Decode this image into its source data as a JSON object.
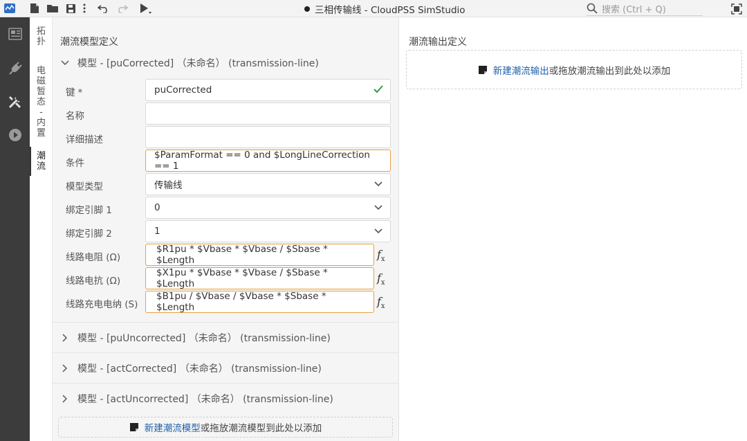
{
  "window": {
    "title": "三相传输线 - CloudPSS SimStudio",
    "search_placeholder": "搜索 (Ctrl + Q)"
  },
  "toolbar_icons": [
    "app-logo-icon",
    "new-file-icon",
    "open-folder-icon",
    "save-icon",
    "more-icon",
    "undo-icon",
    "redo-icon",
    "run-icon"
  ],
  "activity_icons": [
    "component-icon",
    "plug-icon",
    "tools-icon",
    "play-icon"
  ],
  "vertical_tabs": [
    {
      "label": "拓扑",
      "chars": [
        "拓",
        "扑"
      ]
    },
    {
      "label": "电磁暂态-内置",
      "chars": [
        "电",
        "磁",
        "暂",
        "态",
        "-",
        "内",
        "置"
      ]
    },
    {
      "label": "潮流",
      "chars": [
        "潮",
        "流"
      ]
    }
  ],
  "left_panel": {
    "title": "潮流模型定义",
    "expanded_model": {
      "header": "模型 - [puCorrected] （未命名） (transmission-line)",
      "fields": {
        "key_label": "键",
        "key_required": "*",
        "key_value": "puCorrected",
        "name_label": "名称",
        "name_value": "",
        "desc_label": "详细描述",
        "desc_value": "",
        "cond_label": "条件",
        "cond_value": "$ParamFormat == 0 and $LongLineCorrection == 1",
        "type_label": "模型类型",
        "type_value": "传输线",
        "pin1_label": "绑定引脚 1",
        "pin1_value": "0",
        "pin2_label": "绑定引脚 2",
        "pin2_value": "1",
        "r_label": "线路电阻 (Ω)",
        "r_value": "$R1pu * $Vbase * $Vbase / $Sbase * $Length",
        "x_label": "线路电抗 (Ω)",
        "x_value": "$X1pu * $Vbase * $Vbase / $Sbase * $Length",
        "b_label": "线路充电电纳 (S)",
        "b_value": "$B1pu / $Vbase / $Vbase * $Sbase * $Length",
        "fx_label": "f",
        "fx_sub": "x"
      }
    },
    "collapsed_models": [
      "模型 - [puUncorrected] （未命名） (transmission-line)",
      "模型 - [actCorrected] （未命名） (transmission-line)",
      "模型 - [actUncorrected] （未命名） (transmission-line)"
    ],
    "add": {
      "link": "新建潮流模型",
      "text": "或拖放潮流模型到此处以添加"
    }
  },
  "right_panel": {
    "title": "潮流输出定义",
    "add": {
      "link": "新建潮流输出",
      "text": "或拖放潮流输出到此处以添加"
    }
  },
  "colors": {
    "accent_orange": "#e8a040",
    "link_blue": "#1f5fa8",
    "check_green": "#3a9a4a",
    "activity_bg": "#3c3c3c"
  }
}
